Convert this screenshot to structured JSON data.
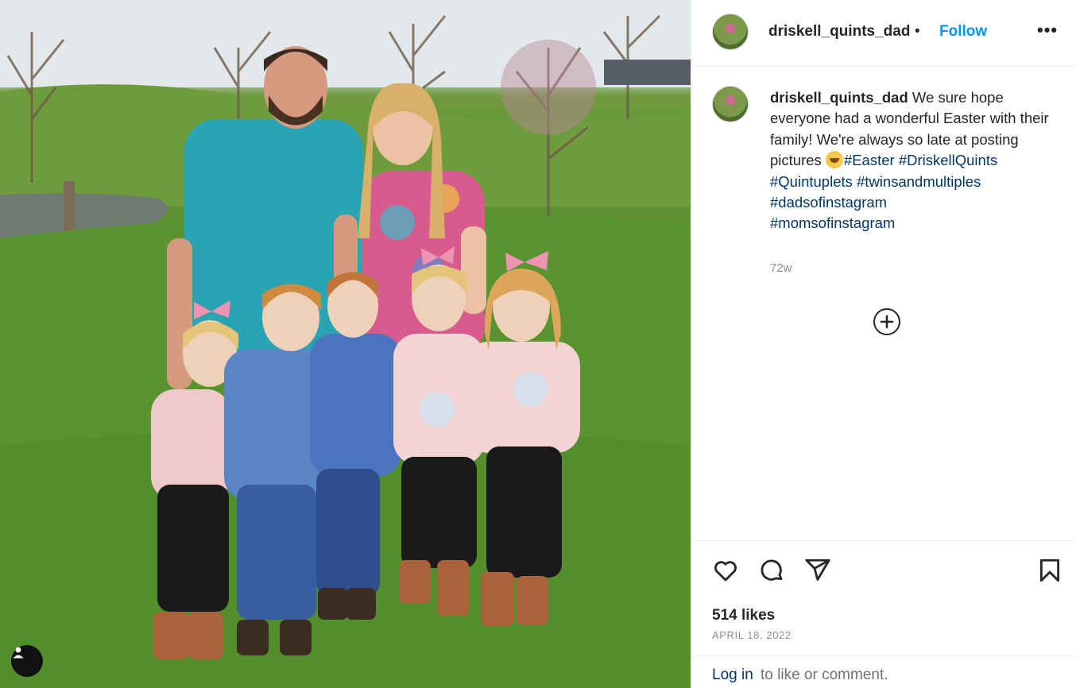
{
  "post": {
    "username": "driskell_quints_dad",
    "separator": "•",
    "follow_label": "Follow",
    "more_label": "•••",
    "caption_text": "We sure hope everyone had a wonderful Easter with their family! We're always so late at posting pictures ",
    "emoji": "laughing-face-emoji",
    "hashtags": [
      "#Easter",
      "#DriskellQuints",
      "#Quintuplets",
      "#twinsandmultiples",
      "#dadsofinstagram",
      "#momsofinstagram"
    ],
    "time_ago": "72w",
    "likes": "514 likes",
    "date": "APRIL 18, 2022",
    "login_label": "Log in",
    "login_rest": " to like or comment."
  },
  "icons": {
    "like": "heart-icon",
    "comment": "comment-icon",
    "share": "send-icon",
    "save": "bookmark-icon",
    "more_comments": "plus-circle-icon",
    "tagged_users": "user-tag-icon"
  },
  "colors": {
    "link_blue": "#0095f6",
    "hashtag": "#00376b",
    "muted": "#8e8e8e"
  }
}
